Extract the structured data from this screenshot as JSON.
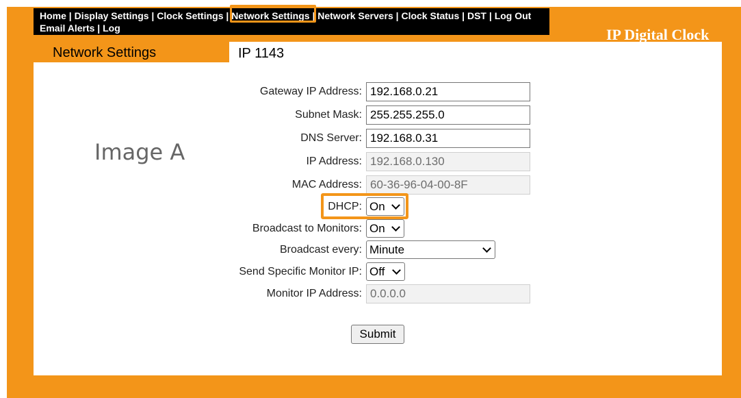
{
  "nav": {
    "items": [
      "Home",
      "Display Settings",
      "Clock Settings",
      "Network Settings",
      "Network Servers",
      "Clock Status",
      "DST",
      "Log Out",
      "Email Alerts",
      "Log"
    ],
    "separator": "|"
  },
  "brand": "IP Digital Clock",
  "tabs": {
    "current": "Network Settings",
    "model": "IP 1143"
  },
  "watermark": "Image A",
  "form": {
    "gateway": {
      "label": "Gateway IP Address:",
      "value": "192.168.0.21"
    },
    "subnet": {
      "label": "Subnet Mask:",
      "value": "255.255.255.0"
    },
    "dns": {
      "label": "DNS Server:",
      "value": "192.168.0.31"
    },
    "ip": {
      "label": "IP Address:",
      "value": "192.168.0.130"
    },
    "mac": {
      "label": "MAC Address:",
      "value": "60-36-96-04-00-8F"
    },
    "dhcp": {
      "label": "DHCP:",
      "value": "On"
    },
    "broadcast": {
      "label": "Broadcast to Monitors:",
      "value": "On"
    },
    "broadcast_every": {
      "label": "Broadcast every:",
      "value": "Minute"
    },
    "send_specific": {
      "label": "Send Specific Monitor IP:",
      "value": "Off"
    },
    "monitor_ip": {
      "label": "Monitor IP Address:",
      "value": "0.0.0.0"
    }
  },
  "submit_label": "Submit",
  "colors": {
    "accent": "#F39519",
    "nav_bg": "#000000"
  }
}
